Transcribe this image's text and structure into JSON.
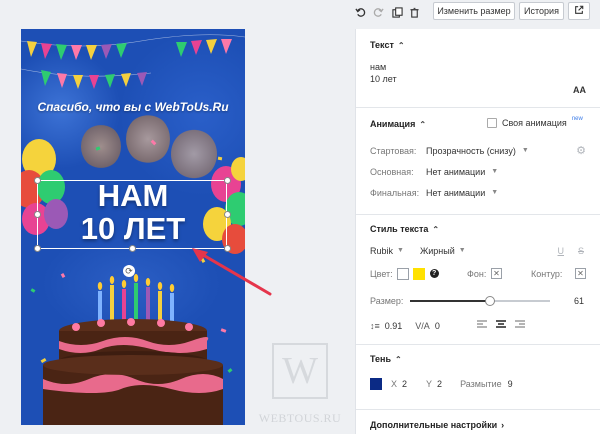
{
  "toolbar": {
    "resize_label": "Изменить размер",
    "history_label": "История"
  },
  "canvas": {
    "thanks_text": "Спасибо, что вы с WebToUs.Ru",
    "headline_line1": "НАМ",
    "headline_line2": "10 ЛЕТ"
  },
  "panel": {
    "text_section": {
      "title": "Текст",
      "line1": "нам",
      "line2": "10 лет",
      "case_label": "AA"
    },
    "animation": {
      "title": "Анимация",
      "own_animation_label": "Своя анимация",
      "own_animation_badge": "new",
      "start_label": "Стартовая:",
      "start_value": "Прозрачность (снизу)",
      "main_label": "Основная:",
      "main_value": "Нет анимации",
      "final_label": "Финальная:",
      "final_value": "Нет анимации"
    },
    "text_style": {
      "title": "Стиль текста",
      "font_family": "Rubik",
      "font_weight": "Жирный",
      "underline_glyph": "U",
      "strike_glyph": "S",
      "color_label": "Цвет:",
      "color_white": "#ffffff",
      "color_yellow": "#ffe100",
      "help_glyph": "?",
      "background_label": "Фон:",
      "outline_label": "Контур:",
      "size_label": "Размер:",
      "size_value": "61",
      "size_slider_fraction": 0.57,
      "line_height_value": "0.91",
      "letter_spacing_label": "V/A",
      "letter_spacing_value": "0"
    },
    "shadow": {
      "title": "Тень",
      "color": "#0b2a85",
      "x_label": "X",
      "x_value": "2",
      "y_label": "Y",
      "y_value": "2",
      "blur_label": "Размытие",
      "blur_value": "9"
    },
    "advanced": {
      "title": "Дополнительные настройки"
    }
  },
  "watermark": {
    "letter": "W",
    "text": "WEBTOUS.RU"
  },
  "colors": {
    "canvas_blue": "#1d4fb5",
    "arrow_red": "#e5354b"
  }
}
